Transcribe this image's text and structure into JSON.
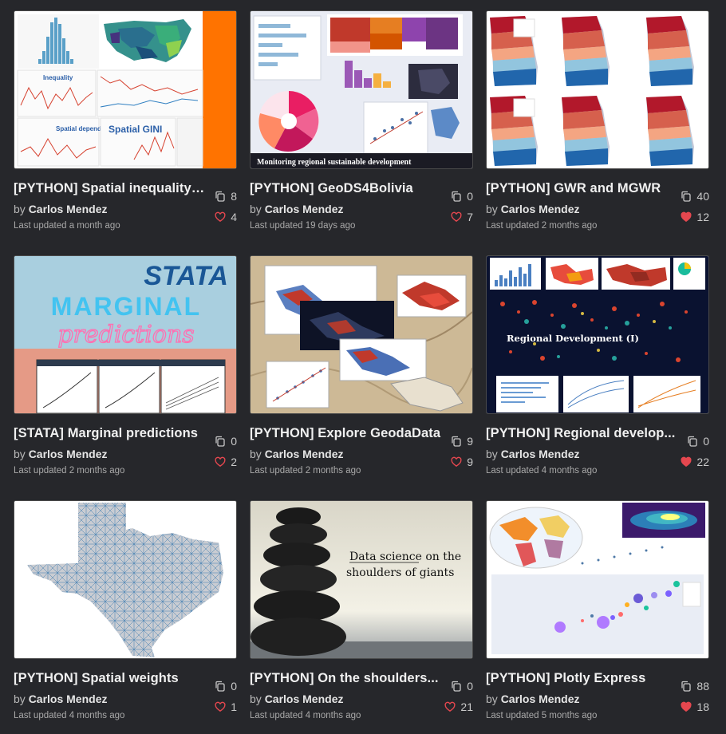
{
  "labels": {
    "by": "by"
  },
  "colors": {
    "heart_filled": "#e5474f",
    "heart_outline": "#e5474f",
    "accent_orange": "#ff7300"
  },
  "cards": [
    {
      "title": "[PYTHON] Spatial inequality ...",
      "author": "Carlos Mendez",
      "updated": "Last updated a month ago",
      "forks": "8",
      "likes": "4",
      "liked": false,
      "thumb_text": [
        "Inequality",
        "Spatial dependence",
        "Spatial GINI"
      ]
    },
    {
      "title": "[PYTHON] GeoDS4Bolivia",
      "author": "Carlos Mendez",
      "updated": "Last updated 19 days ago",
      "forks": "0",
      "likes": "7",
      "liked": false,
      "thumb_text": [
        "Monitoring regional sustainable development"
      ]
    },
    {
      "title": "[PYTHON] GWR and MGWR",
      "author": "Carlos Mendez",
      "updated": "Last updated 2 months ago",
      "forks": "40",
      "likes": "12",
      "liked": true,
      "thumb_text": []
    },
    {
      "title": "[STATA] Marginal predictions",
      "author": "Carlos Mendez",
      "updated": "Last updated 2 months ago",
      "forks": "0",
      "likes": "2",
      "liked": false,
      "thumb_text": [
        "STATA",
        "MARGINAL",
        "predictions"
      ]
    },
    {
      "title": "[PYTHON] Explore GeodaData",
      "author": "Carlos Mendez",
      "updated": "Last updated 2 months ago",
      "forks": "9",
      "likes": "9",
      "liked": false,
      "thumb_text": []
    },
    {
      "title": "[PYTHON] Regional develop...",
      "author": "Carlos Mendez",
      "updated": "Last updated 4 months ago",
      "forks": "0",
      "likes": "22",
      "liked": true,
      "thumb_text": [
        "Regional Development (I)"
      ]
    },
    {
      "title": "[PYTHON] Spatial weights",
      "author": "Carlos Mendez",
      "updated": "Last updated 4 months ago",
      "forks": "0",
      "likes": "1",
      "liked": false,
      "thumb_text": []
    },
    {
      "title": "[PYTHON] On the shoulders...",
      "author": "Carlos Mendez",
      "updated": "Last updated 4 months ago",
      "forks": "0",
      "likes": "21",
      "liked": false,
      "thumb_text": [
        "Data science on the",
        "shoulders of giants"
      ]
    },
    {
      "title": "[PYTHON] Plotly Express",
      "author": "Carlos Mendez",
      "updated": "Last updated 5 months ago",
      "forks": "88",
      "likes": "18",
      "liked": true,
      "thumb_text": []
    }
  ]
}
